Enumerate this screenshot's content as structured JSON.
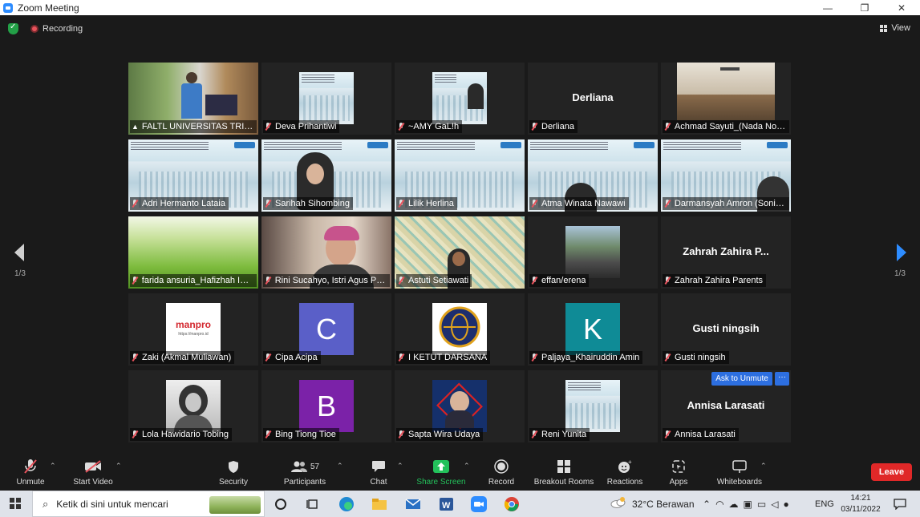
{
  "window": {
    "title": "Zoom Meeting",
    "minimize": "—",
    "maximize": "❐",
    "close": "✕"
  },
  "meeting": {
    "recording_label": "Recording",
    "view_label": "View",
    "page_indicator": "1/3"
  },
  "tiles": [
    {
      "name": "FALTL UNIVERSITAS TRISAKTI",
      "kind": "video-speaker",
      "active": true,
      "muted": false
    },
    {
      "name": "Deva Prihantiwi",
      "kind": "slide-small",
      "muted": true
    },
    {
      "name": "~AMY GaL!h",
      "kind": "slide-person-small",
      "muted": true
    },
    {
      "name": "Derliana",
      "kind": "name",
      "display": "Derliana",
      "muted": true
    },
    {
      "name": "Achmad Sayuti_(Nada Noer)",
      "kind": "room-photo",
      "muted": true
    },
    {
      "name": "Adri Hermanto Lataia",
      "kind": "slide-full",
      "muted": true
    },
    {
      "name": "Sarihah Sihombing",
      "kind": "slide-person",
      "muted": true
    },
    {
      "name": "Lilik Herlina",
      "kind": "slide-full",
      "muted": true
    },
    {
      "name": "Atma Winata Nawawi",
      "kind": "slide-person-bottom",
      "muted": true
    },
    {
      "name": "Darmansyah Amron (Sonia...",
      "kind": "slide-person-right",
      "muted": true
    },
    {
      "name": "farida ansuria_Hafizhah Idz...",
      "kind": "grass",
      "muted": true
    },
    {
      "name": "Rini Sucahyo, Istri Agus Pur...",
      "kind": "webcam-room",
      "muted": true
    },
    {
      "name": "Astuti Setiawati",
      "kind": "webcam-pattern",
      "muted": true
    },
    {
      "name": "effan/erena",
      "kind": "photo-small",
      "muted": true
    },
    {
      "name": "Zahrah Zahira Parents",
      "kind": "name",
      "display": "Zahrah Zahira P...",
      "muted": true
    },
    {
      "name": "Zaki (Akmal Muliawan)",
      "kind": "logo-manpro",
      "logo_text": "manpro",
      "logo_url": "https://manpro.id",
      "muted": true
    },
    {
      "name": "Cipa Acipa",
      "kind": "avatar",
      "letter": "C",
      "color": "#5a5fc8",
      "muted": true
    },
    {
      "name": "I KETUT DARSANA",
      "kind": "emblem",
      "muted": true
    },
    {
      "name": "Paljaya_Khairuddin Amin",
      "kind": "avatar",
      "letter": "K",
      "color": "#0f8b96",
      "muted": true
    },
    {
      "name": "Gusti ningsih",
      "kind": "name",
      "display": "Gusti ningsih",
      "muted": true
    },
    {
      "name": "Lola Hawidario Tobing",
      "kind": "bw-photo",
      "muted": true
    },
    {
      "name": "Bing Tiong Tioe",
      "kind": "avatar",
      "letter": "B",
      "color": "#7b22a8",
      "muted": true
    },
    {
      "name": "Sapta Wira Udaya",
      "kind": "profile-badge",
      "muted": true
    },
    {
      "name": "Reni Yunita",
      "kind": "slide-small",
      "muted": true
    },
    {
      "name": "Annisa Larasati",
      "kind": "name",
      "display": "Annisa Larasati",
      "muted": true
    }
  ],
  "hover": {
    "ask_to_unmute": "Ask to Unmute",
    "more": "···"
  },
  "toolbar": {
    "unmute": "Unmute",
    "start_video": "Start Video",
    "security": "Security",
    "participants": "Participants",
    "participants_count": "57",
    "chat": "Chat",
    "share_screen": "Share Screen",
    "record": "Record",
    "breakout_rooms": "Breakout Rooms",
    "reactions": "Reactions",
    "apps": "Apps",
    "whiteboards": "Whiteboards",
    "leave": "Leave"
  },
  "taskbar": {
    "search_placeholder": "Ketik di sini untuk mencari",
    "weather": "32°C  Berawan",
    "language": "ENG",
    "time": "14:21",
    "date": "03/11/2022"
  },
  "colors": {
    "accent": "#2d8cff",
    "active_speaker": "#e3e83a",
    "share_green": "#23c15b",
    "leave_red": "#e02828",
    "muted_red": "#e8535c"
  }
}
